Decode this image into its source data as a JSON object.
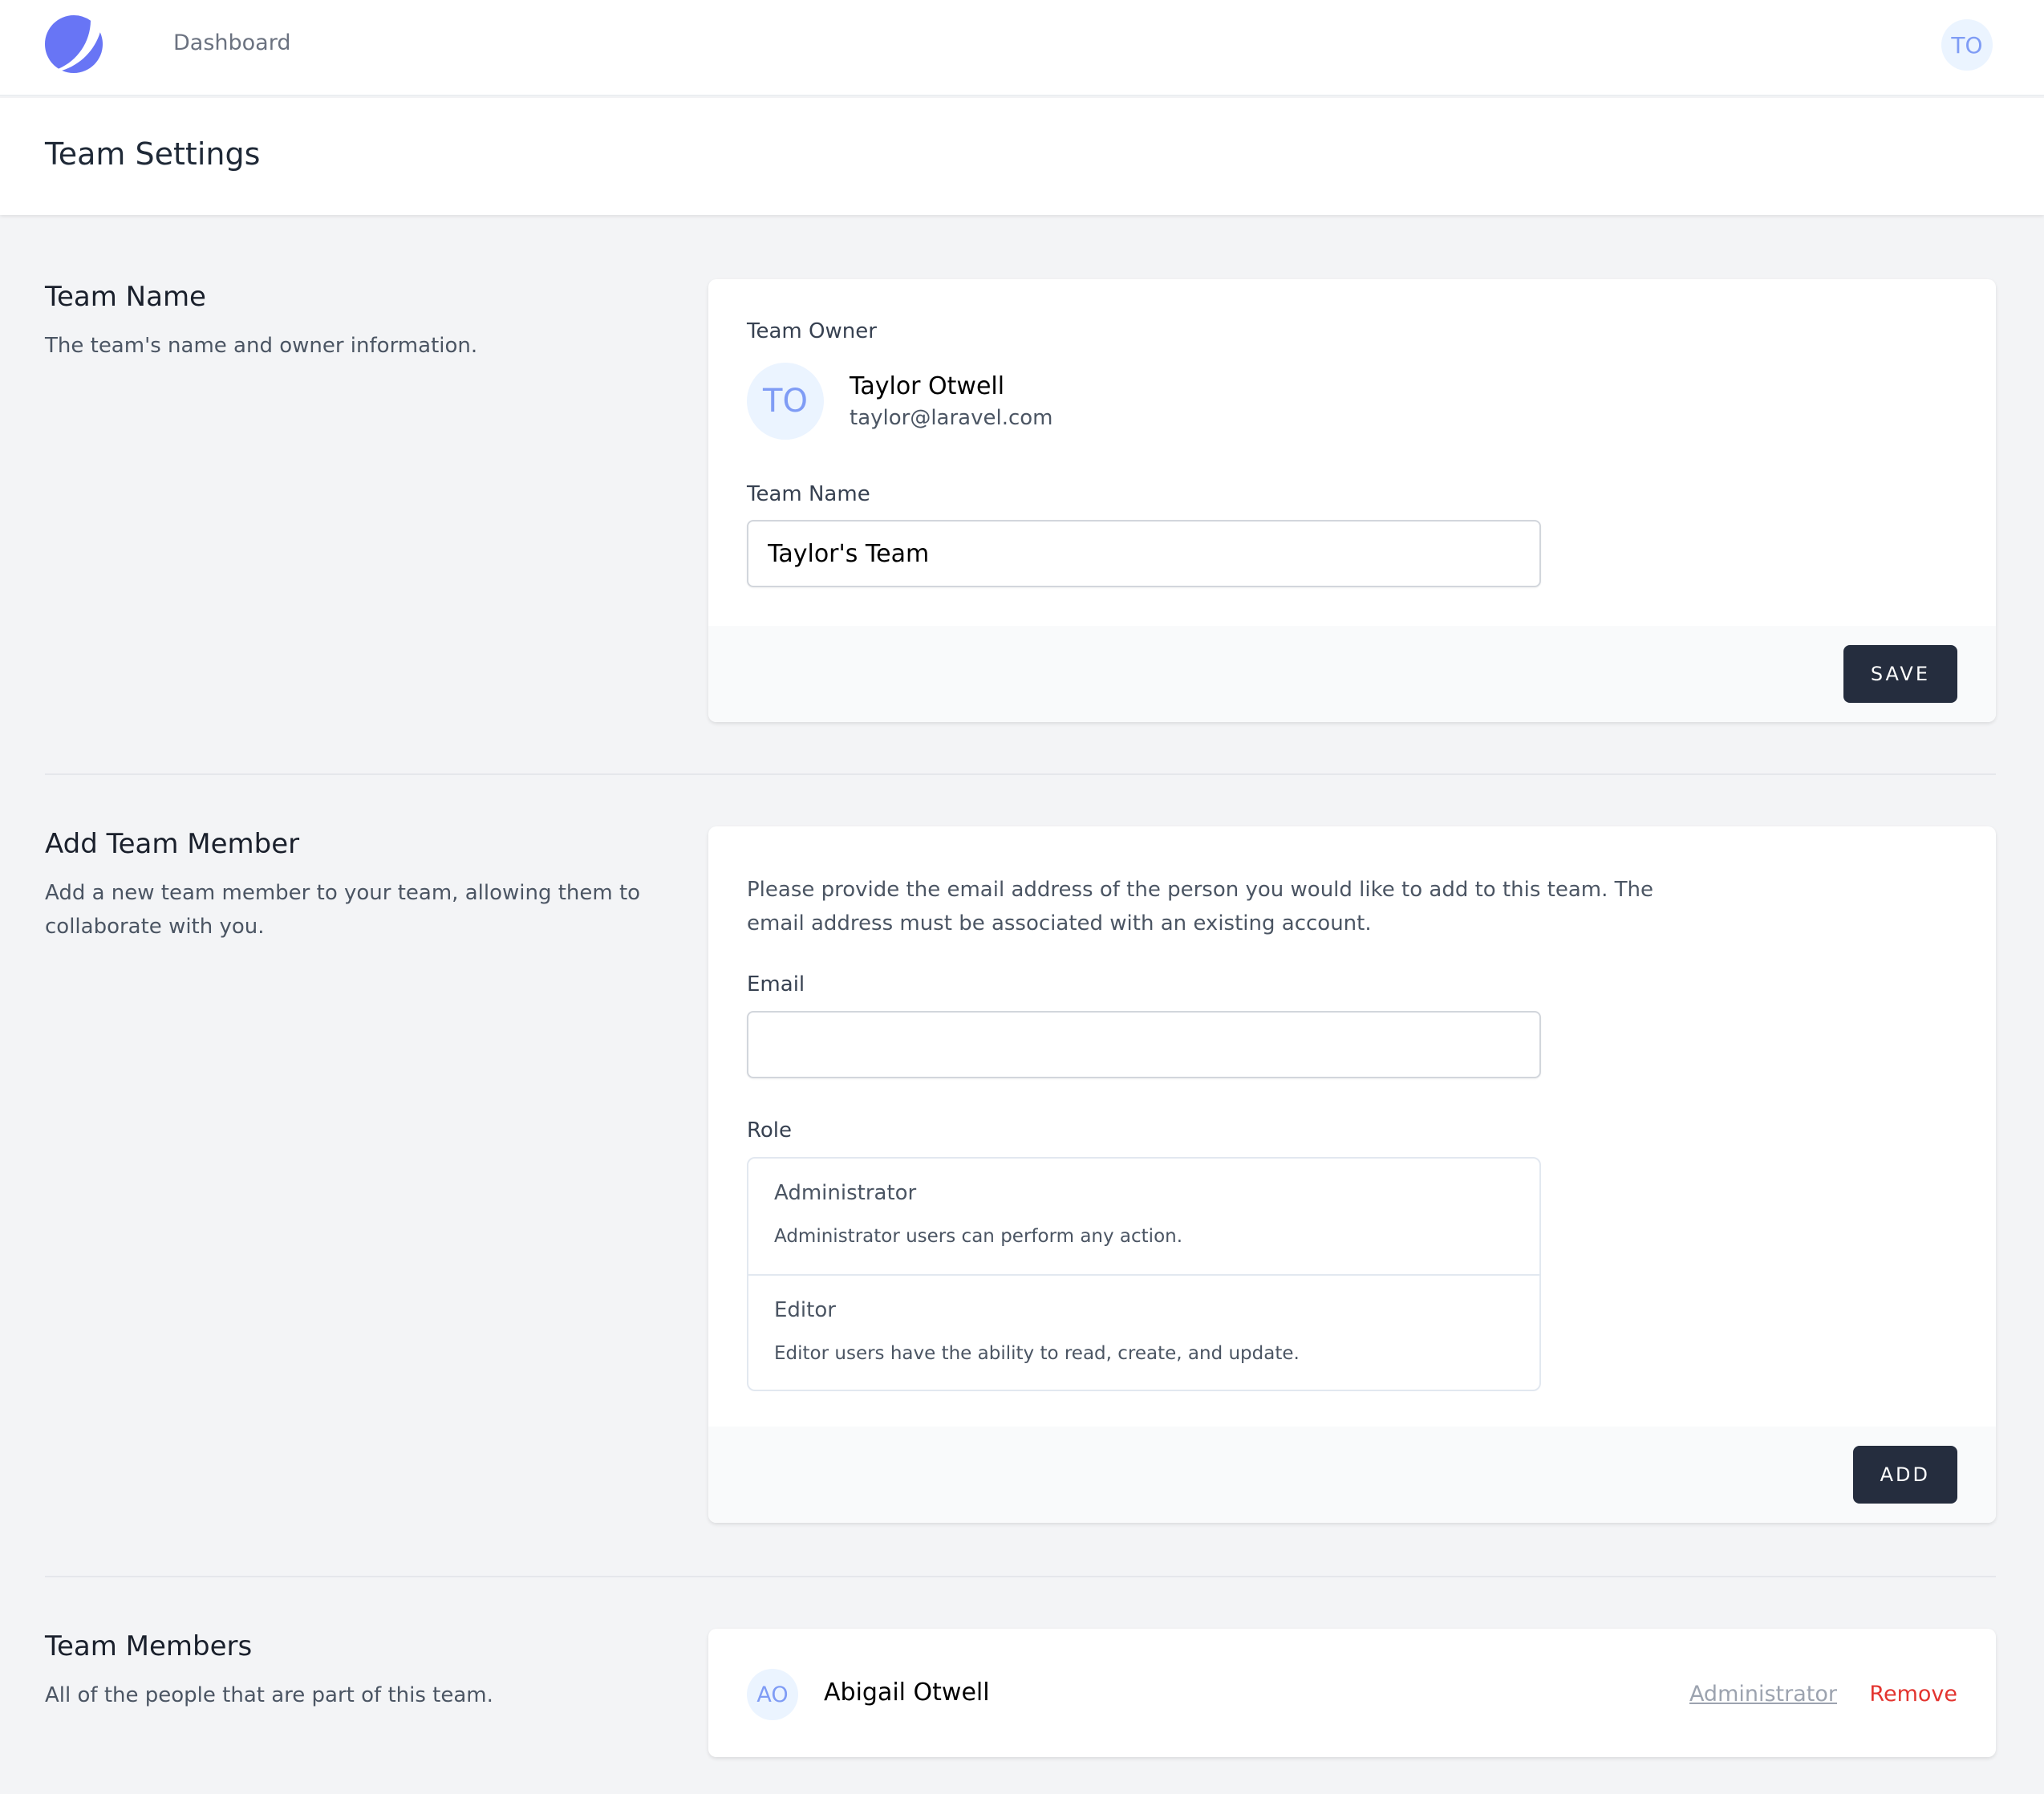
{
  "nav": {
    "links": [
      {
        "label": "Dashboard"
      }
    ],
    "user_initials": "TO",
    "logo_color": "#6875f5"
  },
  "header": {
    "title": "Team Settings"
  },
  "team_name_section": {
    "title": "Team Name",
    "description": "The team's name and owner information.",
    "owner_label": "Team Owner",
    "owner": {
      "initials": "TO",
      "name": "Taylor Otwell",
      "email": "taylor@laravel.com"
    },
    "name_label": "Team Name",
    "name_value": "Taylor's Team",
    "save_label": "SAVE"
  },
  "add_member_section": {
    "title": "Add Team Member",
    "description": "Add a new team member to your team, allowing them to collaborate with you.",
    "info": "Please provide the email address of the person you would like to add to this team. The email address must be associated with an existing account.",
    "email_label": "Email",
    "email_value": "",
    "role_label": "Role",
    "roles": [
      {
        "name": "Administrator",
        "description": "Administrator users can perform any action."
      },
      {
        "name": "Editor",
        "description": "Editor users have the ability to read, create, and update."
      }
    ],
    "add_label": "ADD"
  },
  "members_section": {
    "title": "Team Members",
    "description": "All of the people that are part of this team.",
    "members": [
      {
        "initials": "AO",
        "name": "Abigail Otwell",
        "role": "Administrator",
        "remove_label": "Remove"
      }
    ]
  },
  "colors": {
    "button_bg": "#252d3e",
    "avatar_bg": "#ebf4ff",
    "avatar_text": "#7f9cf5",
    "remove_text": "#e3342f",
    "page_bg": "#f3f4f6"
  }
}
